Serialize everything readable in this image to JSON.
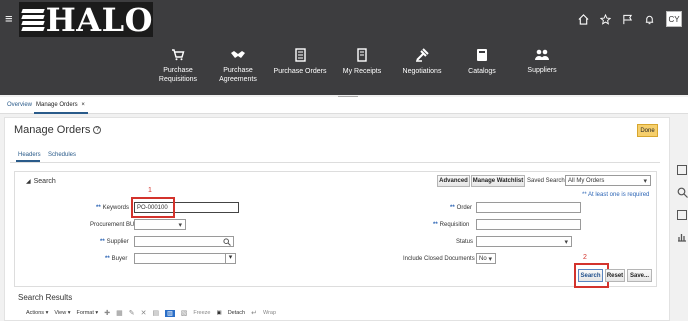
{
  "header": {
    "brand": "HALO",
    "avatar_initials": "CY",
    "icons": [
      "home-icon",
      "star-icon",
      "flag-icon",
      "bell-icon"
    ]
  },
  "nav": [
    {
      "label": "Purchase Requisitions",
      "icon": "cart-icon"
    },
    {
      "label": "Purchase Agreements",
      "icon": "handshake-icon"
    },
    {
      "label": "Purchase Orders",
      "icon": "document-icon"
    },
    {
      "label": "My Receipts",
      "icon": "receipt-icon"
    },
    {
      "label": "Negotiations",
      "icon": "gavel-icon"
    },
    {
      "label": "Catalogs",
      "icon": "book-icon"
    },
    {
      "label": "Suppliers",
      "icon": "people-icon"
    }
  ],
  "tabs": {
    "overview": "Overview",
    "manage_orders": "Manage Orders",
    "close": "×"
  },
  "page": {
    "title": "Manage Orders",
    "done": "Done"
  },
  "subtabs": {
    "headers": "Headers",
    "schedules": "Schedules"
  },
  "search": {
    "title": "Search",
    "advanced": "Advanced",
    "manage_watchlist": "Manage Watchlist",
    "saved_search_label": "Saved Search",
    "saved_search_value": "All My Orders",
    "at_least_one": "** At least one is required",
    "keywords_label": "Keywords",
    "keywords_value": "PO-000100",
    "procurement_bu_label": "Procurement BU",
    "supplier_label": "Supplier",
    "buyer_label": "Buyer",
    "order_label": "Order",
    "requisition_label": "Requisition",
    "status_label": "Status",
    "include_closed_label": "Include Closed Documents",
    "include_closed_value": "No",
    "search_btn": "Search",
    "reset_btn": "Reset",
    "save_btn": "Save..."
  },
  "callouts": {
    "one": "1",
    "two": "2"
  },
  "results": {
    "title": "Search Results",
    "actions": "Actions",
    "view": "View",
    "format": "Format",
    "freeze": "Freeze",
    "detach": "Detach",
    "wrap": "Wrap"
  }
}
